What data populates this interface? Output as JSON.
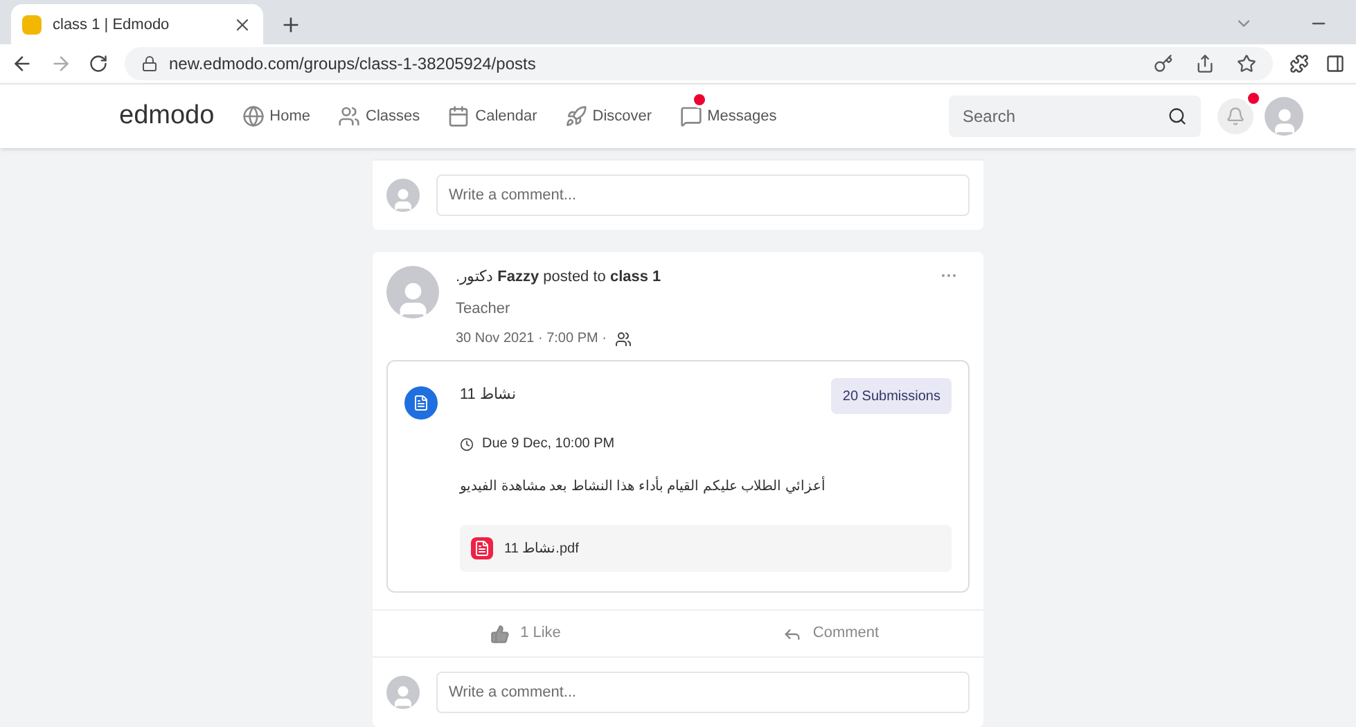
{
  "browser": {
    "tab_title": "class 1 | Edmodo",
    "address": "new.edmodo.com/groups/class-1-38205924/posts"
  },
  "nav": {
    "logo": "edmodo",
    "items": [
      {
        "label": "Home",
        "kind": "home"
      },
      {
        "label": "Classes",
        "kind": "classes"
      },
      {
        "label": "Calendar",
        "kind": "calendar"
      },
      {
        "label": "Discover",
        "kind": "discover"
      },
      {
        "label": "Messages",
        "kind": "messages",
        "badge": true
      }
    ],
    "search_placeholder": "Search",
    "notifications_badge": true
  },
  "previous_post": {
    "comment_placeholder": "Write a comment..."
  },
  "post": {
    "header": ".دكتور **Fazzy** posted to **class 1**",
    "role": "Teacher",
    "date": "30 Nov 2021 · 7:00 PM ·",
    "assignment": {
      "title": "نشاط 11",
      "submissions": "20 Submissions",
      "due": "Due 9 Dec, 10:00 PM",
      "description": "أعزائي الطلاب عليكم القيام بأداء هذا النشاط بعد مشاهدة الفيديو",
      "attachment": "نشاط 11.pdf"
    },
    "like": "1 Like",
    "comment": "Comment",
    "comment_placeholder": "Write a comment..."
  }
}
